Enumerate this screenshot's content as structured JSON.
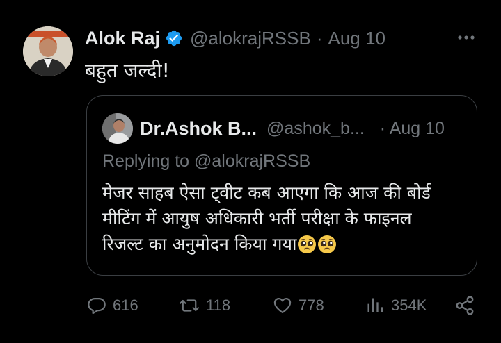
{
  "tweet": {
    "author_name": "Alok Raj",
    "author_handle": "@alokrajRSSB",
    "separator": "·",
    "date": "Aug 10",
    "text": "बहुत जल्दी!",
    "verified_color": "#1d9bf0"
  },
  "quoted": {
    "author_name": "Dr.Ashok B...",
    "author_handle": "@ashok_b...",
    "date": "· Aug 10",
    "replying": "Replying to @alokrajRSSB",
    "lines": [
      "मेजर साहब ऐसा ट्वीट कब आएगा कि आज की बोर्ड",
      "मीटिंग में आयुष अधिकारी भर्ती परीक्षा के फाइनल",
      "रिजल्ट का अनुमोदन किया गया"
    ],
    "emoji": [
      "pleading-face",
      "pleading-face"
    ]
  },
  "actions": {
    "replies": "616",
    "retweets": "118",
    "likes": "778",
    "views": "354K"
  },
  "icons": [
    "more-icon",
    "verified-badge-icon",
    "reply-icon",
    "retweet-icon",
    "like-icon",
    "views-icon",
    "share-icon"
  ],
  "colors": {
    "background": "#000000",
    "text": "#e7e9ea",
    "muted": "#71767b",
    "border": "#3a3e42"
  }
}
